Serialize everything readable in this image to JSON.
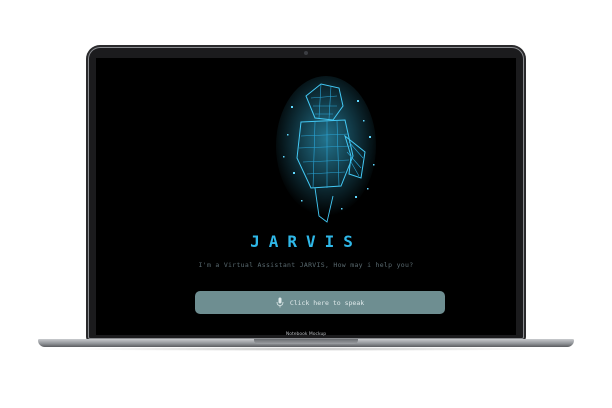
{
  "app": {
    "title": "JARVIS",
    "subtitle": "I'm a Virtual Assistant JARVIS, How may i help you?"
  },
  "speak_button": {
    "label": "Click here to speak",
    "icon": "mic-icon"
  },
  "device": {
    "label": "Notebook Mockup"
  },
  "colors": {
    "accent": "#2fb8e8",
    "button": "#6e8e91",
    "screen_bg": "#000000"
  }
}
